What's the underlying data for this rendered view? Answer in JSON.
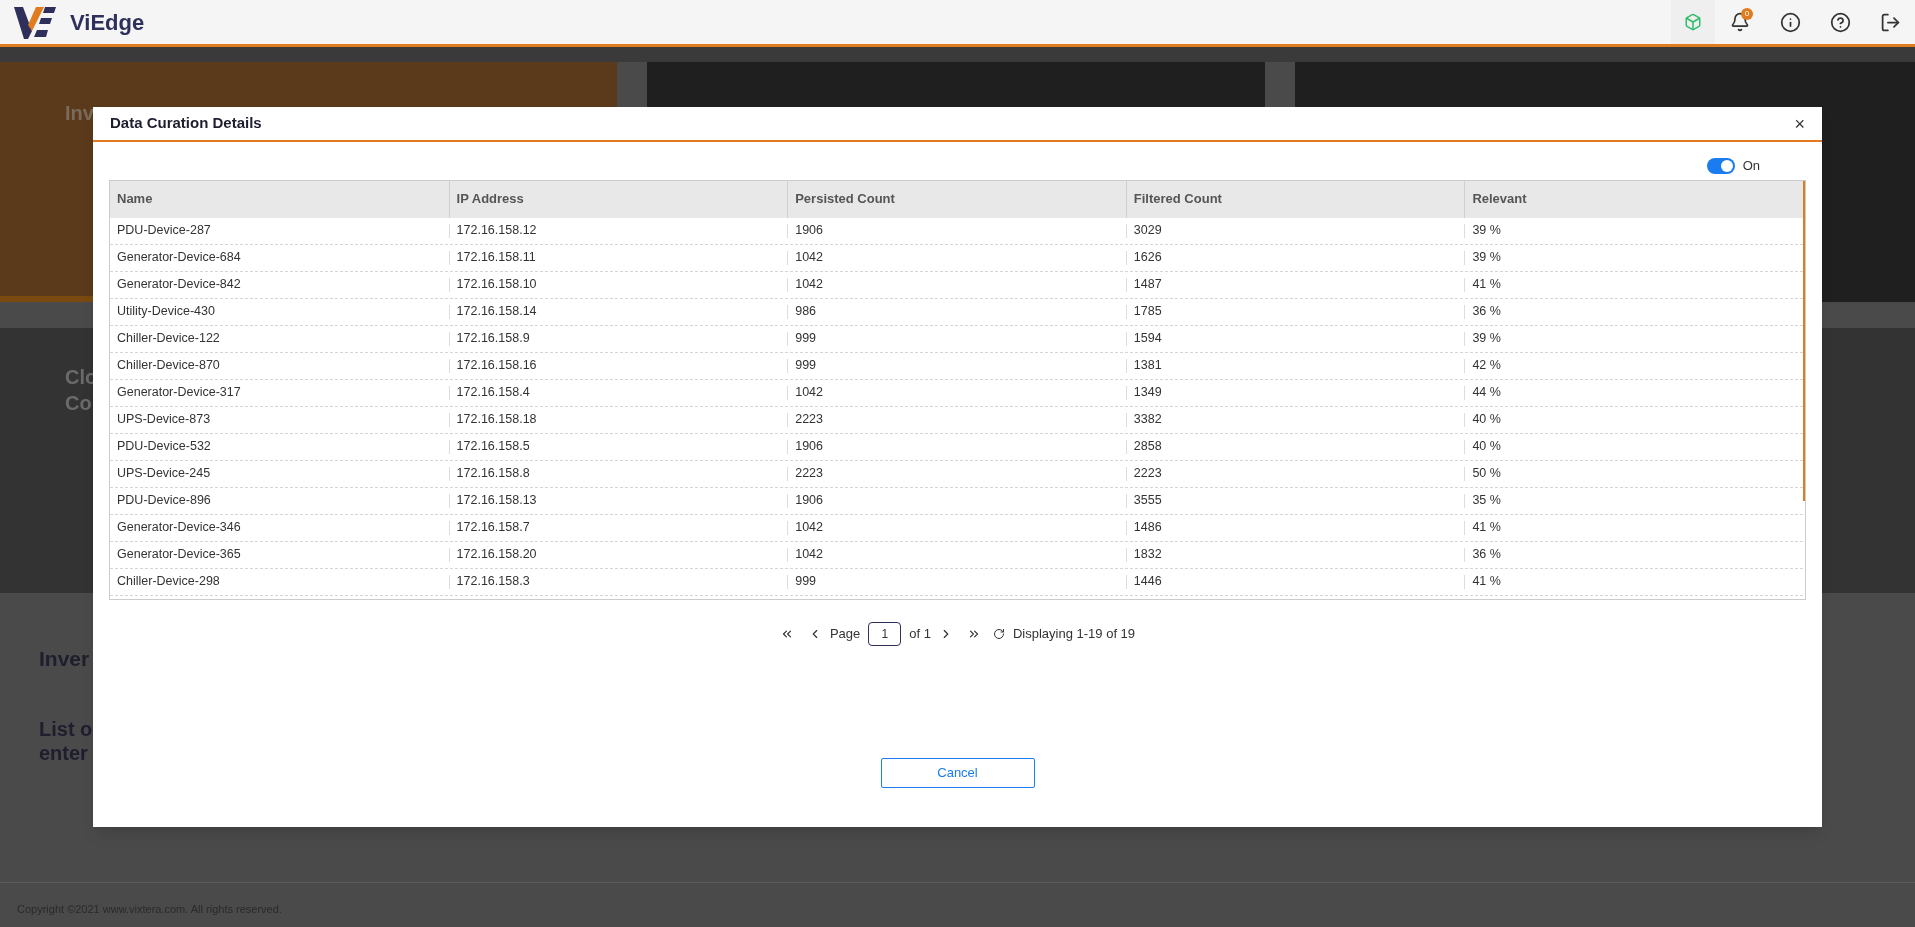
{
  "header": {
    "brand": "ViEdge",
    "notification_count": "0"
  },
  "background": {
    "cards": [
      "Inv",
      "Clo\nCo"
    ],
    "section_title": "Inver",
    "section_text": "List o\nenter",
    "footer": "Copyright ©2021 www.vixtera.com. All rights reserved."
  },
  "dialog": {
    "title": "Data Curation Details",
    "close": "×",
    "toggle": {
      "on": true,
      "label": "On"
    },
    "table": {
      "columns": [
        "Name",
        "IP Address",
        "Persisted Count",
        "Filtered Count",
        "Relevant"
      ],
      "rows": [
        [
          "PDU-Device-287",
          "172.16.158.12",
          "1906",
          "3029",
          "39 %"
        ],
        [
          "Generator-Device-684",
          "172.16.158.11",
          "1042",
          "1626",
          "39 %"
        ],
        [
          "Generator-Device-842",
          "172.16.158.10",
          "1042",
          "1487",
          "41 %"
        ],
        [
          "Utility-Device-430",
          "172.16.158.14",
          "986",
          "1785",
          "36 %"
        ],
        [
          "Chiller-Device-122",
          "172.16.158.9",
          "999",
          "1594",
          "39 %"
        ],
        [
          "Chiller-Device-870",
          "172.16.158.16",
          "999",
          "1381",
          "42 %"
        ],
        [
          "Generator-Device-317",
          "172.16.158.4",
          "1042",
          "1349",
          "44 %"
        ],
        [
          "UPS-Device-873",
          "172.16.158.18",
          "2223",
          "3382",
          "40 %"
        ],
        [
          "PDU-Device-532",
          "172.16.158.5",
          "1906",
          "2858",
          "40 %"
        ],
        [
          "UPS-Device-245",
          "172.16.158.8",
          "2223",
          "2223",
          "50 %"
        ],
        [
          "PDU-Device-896",
          "172.16.158.13",
          "1906",
          "3555",
          "35 %"
        ],
        [
          "Generator-Device-346",
          "172.16.158.7",
          "1042",
          "1486",
          "41 %"
        ],
        [
          "Generator-Device-365",
          "172.16.158.20",
          "1042",
          "1832",
          "36 %"
        ],
        [
          "Chiller-Device-298",
          "172.16.158.3",
          "999",
          "1446",
          "41 %"
        ]
      ]
    },
    "pagination": {
      "page_label": "Page",
      "page_value": "1",
      "of": "of 1",
      "status": "Displaying 1-19 of 19"
    },
    "cancel": "Cancel"
  }
}
